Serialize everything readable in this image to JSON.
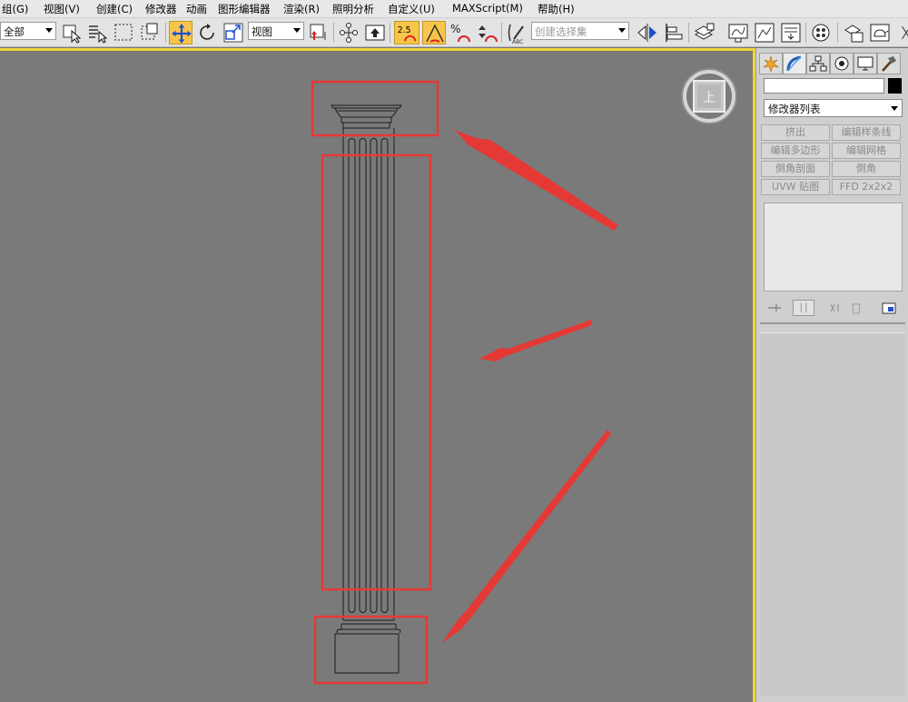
{
  "menu": {
    "items": [
      "组(G)",
      "视图(V)",
      "创建(C)",
      "修改器",
      "动画",
      "图形编辑器",
      "渲染(R)",
      "照明分析",
      "自定义(U)",
      "MAXScript(M)",
      "帮助(H)"
    ]
  },
  "toolbar": {
    "selection_filter": "全部",
    "ref_coord": "视图",
    "snap_value": "2.5",
    "named_selection": "创建选择集",
    "icons": [
      "select-object-icon",
      "select-by-name-icon",
      "rect-selection-icon",
      "window-crossing-icon",
      "select-move-icon",
      "rotate-icon",
      "scale-icon",
      "pivot-icon",
      "link-icon",
      "keyboard-shortcut-icon",
      "snap-2-5-icon",
      "angle-snap-icon",
      "percent-snap-icon",
      "spinner-snap-icon",
      "edit-named-selection-icon",
      "mirror-icon",
      "align-icon",
      "layer-manager-icon",
      "curve-editor-icon",
      "schematic-view-icon",
      "material-editor-icon",
      "render-setup-icon",
      "render-frame-icon",
      "render-teapot-icon"
    ]
  },
  "viewport": {
    "viewcube_face": "上",
    "highlight_color": "#e53935",
    "active_border": "#f0d33a"
  },
  "command_panel": {
    "name_value": "",
    "color_swatch": "#000000",
    "modifier_list": "修改器列表",
    "buttons": [
      "挤出",
      "编辑样条线",
      "编辑多边形",
      "编辑网格",
      "倒角剖面",
      "倒角",
      "UVW 贴图",
      "FFD 2x2x2"
    ]
  }
}
